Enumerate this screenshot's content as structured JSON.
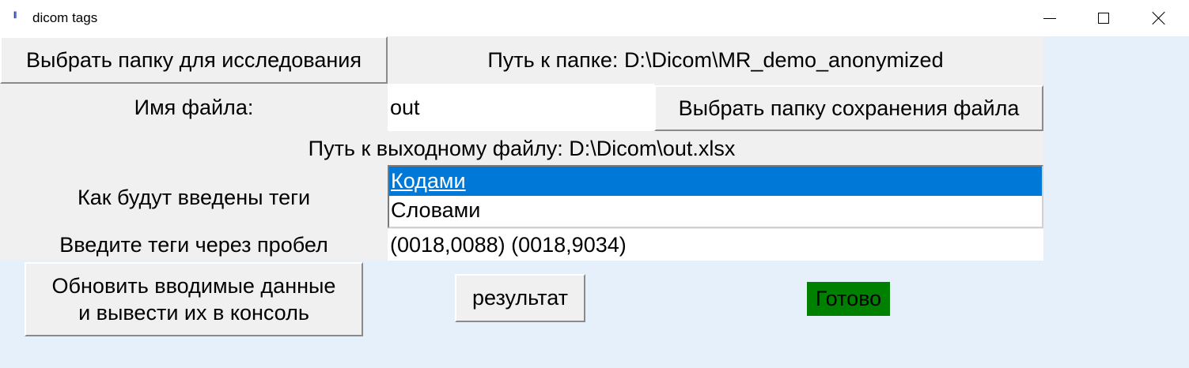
{
  "window": {
    "title": "dicom tags",
    "icon": "dicom-app-icon",
    "icon_glyph": "ꟾꟾ"
  },
  "study": {
    "choose_folder_button": "Выбрать папку для исследования",
    "folder_path_label": "Путь к папке: D:\\Dicom\\MR_demo_anonymized"
  },
  "file": {
    "name_label": "Имя файла:",
    "name_value": "out",
    "choose_save_folder_button": "Выбрать папку сохранения файла",
    "output_path_label": "Путь к выходному файлу: D:\\Dicom\\out.xlsx"
  },
  "tags_mode": {
    "label": "Как будут введены теги",
    "options": [
      "Кодами",
      "Словами"
    ],
    "selected_index": 0
  },
  "tags_input": {
    "label": "Введите теги через пробел",
    "value": "(0018,0088) (0018,9034)"
  },
  "actions": {
    "update_line1": "Обновить вводимые данные",
    "update_line2": "и вывести их в консоль",
    "result_button": "результат"
  },
  "status": {
    "text": "Готово",
    "color": "#008000"
  },
  "colors": {
    "background": "#e6f0fb",
    "panel": "#f0f0f0",
    "selection": "#0078d7"
  }
}
